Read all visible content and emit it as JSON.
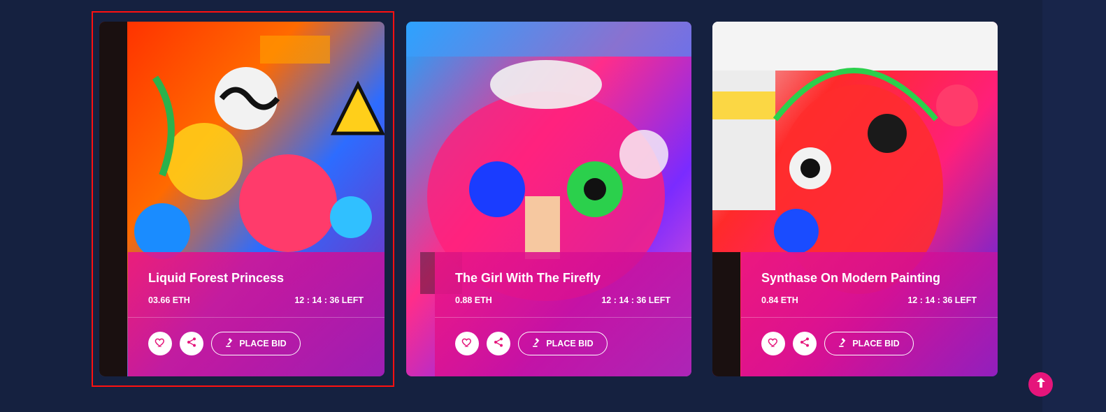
{
  "cards": [
    {
      "title": "Liquid Forest Princess",
      "price": "03.66 ETH",
      "time_left": "12 : 14 : 36 LEFT",
      "bid_label": "PLACE BID"
    },
    {
      "title": "The Girl With The Firefly",
      "price": "0.88 ETH",
      "time_left": "12 : 14 : 36 LEFT",
      "bid_label": "PLACE BID"
    },
    {
      "title": "Synthase On Modern Painting",
      "price": "0.84 ETH",
      "time_left": "12 : 14 : 36 LEFT",
      "bid_label": "PLACE BID"
    }
  ],
  "icons": {
    "like": "heart-icon",
    "share": "share-icon",
    "bid": "gavel-icon",
    "scroll_top": "arrow-up-icon"
  },
  "colors": {
    "background": "#152140",
    "panel_pink": "#ea1686",
    "panel_purple": "#a01eb4",
    "accent": "#e5157b",
    "annotation_red": "#ff1010"
  }
}
